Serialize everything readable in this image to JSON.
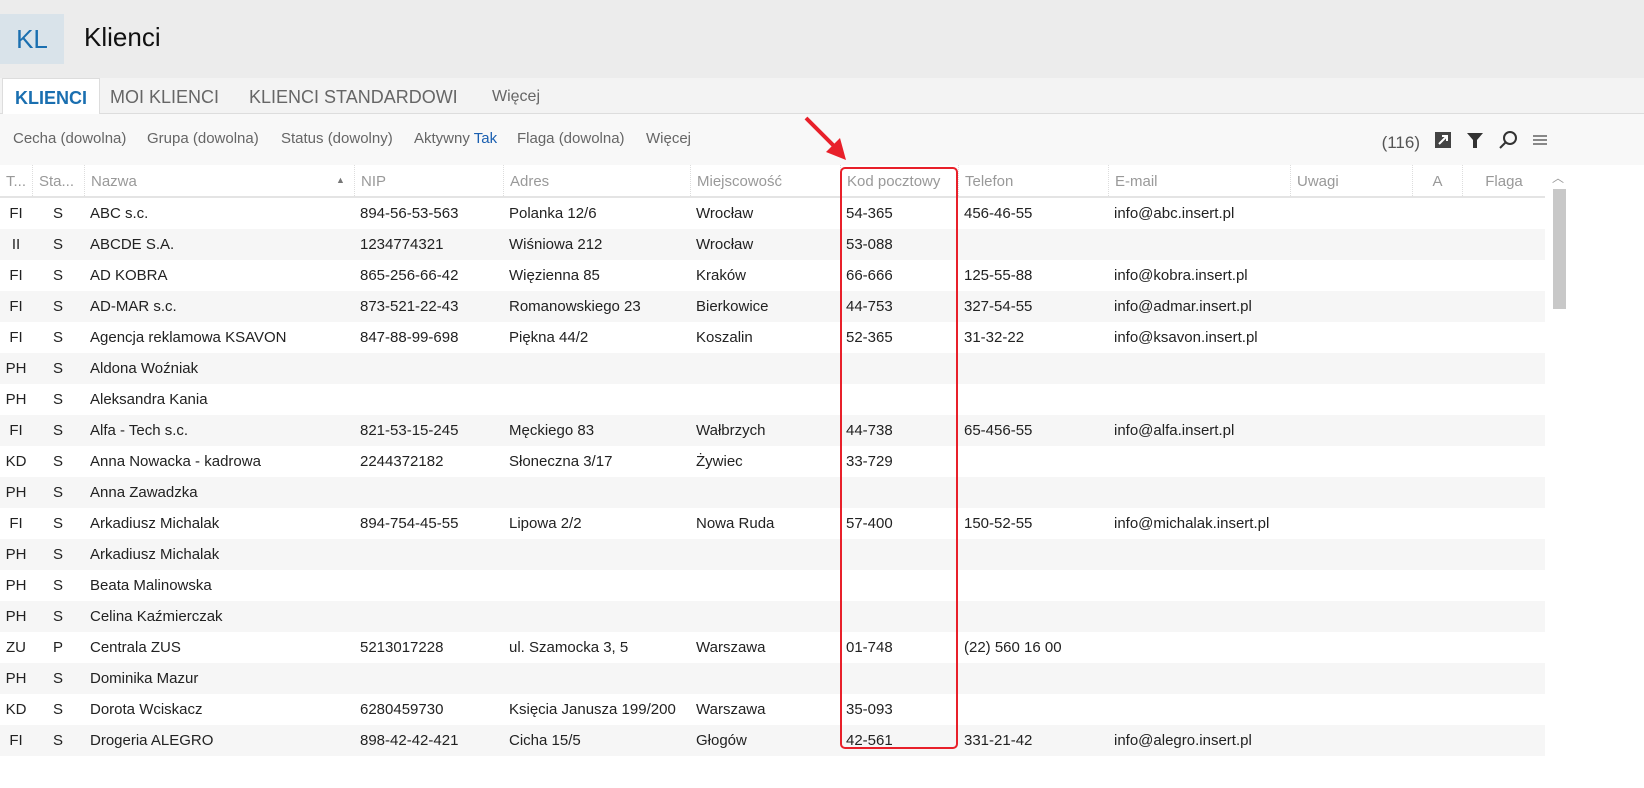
{
  "header": {
    "badge": "KL",
    "title": "Klienci"
  },
  "tabs": [
    {
      "label": "KLIENCI"
    },
    {
      "label": "MOI KLIENCI"
    },
    {
      "label": "KLIENCI STANDARDOWI"
    },
    {
      "label": "Więcej"
    }
  ],
  "filters": {
    "cecha": "Cecha (dowolna)",
    "grupa": "Grupa (dowolna)",
    "status": "Status (dowolny)",
    "aktywny_label": "Aktywny",
    "aktywny_value": "Tak",
    "flaga": "Flaga (dowolna)",
    "more": "Więcej"
  },
  "toolbar": {
    "count": "(116)"
  },
  "columns": [
    "T...",
    "Sta...",
    "Nazwa",
    "NIP",
    "Adres",
    "Miejscowość",
    "Kod pocztowy",
    "Telefon",
    "E-mail",
    "Uwagi",
    "A",
    "Flaga"
  ],
  "rows": [
    [
      "FI",
      "S",
      "ABC s.c.",
      "894-56-53-563",
      "Polanka  12/6",
      "Wrocław",
      "54-365",
      "456-46-55",
      "info@abc.insert.pl"
    ],
    [
      "II",
      "S",
      "ABCDE S.A.",
      "1234774321",
      "Wiśniowa 212",
      "Wrocław",
      "53-088",
      "",
      ""
    ],
    [
      "FI",
      "S",
      "AD KOBRA",
      "865-256-66-42",
      "Więzienna  85",
      "Kraków",
      "66-666",
      "125-55-88",
      "info@kobra.insert.pl"
    ],
    [
      "FI",
      "S",
      "AD-MAR s.c.",
      "873-521-22-43",
      "Romanowskiego 23",
      "Bierkowice",
      "44-753",
      "327-54-55",
      "info@admar.insert.pl"
    ],
    [
      "FI",
      "S",
      "Agencja reklamowa KSAVON",
      "847-88-99-698",
      "Piękna  44/2",
      "Koszalin",
      "52-365",
      "31-32-22",
      "info@ksavon.insert.pl"
    ],
    [
      "PH",
      "S",
      "Aldona Woźniak",
      "",
      "",
      "",
      "",
      "",
      ""
    ],
    [
      "PH",
      "S",
      "Aleksandra Kania",
      "",
      "",
      "",
      "",
      "",
      ""
    ],
    [
      "FI",
      "S",
      "Alfa - Tech s.c.",
      "821-53-15-245",
      "Męckiego  83",
      "Wałbrzych",
      "44-738",
      "65-456-55",
      "info@alfa.insert.pl"
    ],
    [
      "KD",
      "S",
      "Anna Nowacka - kadrowa",
      "2244372182",
      "Słoneczna 3/17",
      "Żywiec",
      "33-729",
      "",
      ""
    ],
    [
      "PH",
      "S",
      "Anna Zawadzka",
      "",
      "",
      "",
      "",
      "",
      ""
    ],
    [
      "FI",
      "S",
      "Arkadiusz Michalak",
      "894-754-45-55",
      "Lipowa  2/2",
      "Nowa Ruda",
      "57-400",
      "150-52-55",
      "info@michalak.insert.pl"
    ],
    [
      "PH",
      "S",
      "Arkadiusz Michalak",
      "",
      "",
      "",
      "",
      "",
      ""
    ],
    [
      "PH",
      "S",
      "Beata Malinowska",
      "",
      "",
      "",
      "",
      "",
      ""
    ],
    [
      "PH",
      "S",
      "Celina Kaźmierczak",
      "",
      "",
      "",
      "",
      "",
      ""
    ],
    [
      "ZU",
      "P",
      "Centrala ZUS",
      "5213017228",
      "ul. Szamocka 3, 5",
      "Warszawa",
      "01-748",
      "(22) 560 16 00",
      ""
    ],
    [
      "PH",
      "S",
      "Dominika Mazur",
      "",
      "",
      "",
      "",
      "",
      ""
    ],
    [
      "KD",
      "S",
      "Dorota Wciskacz",
      "6280459730",
      "Księcia Janusza 199/200",
      "Warszawa",
      "35-093",
      "",
      ""
    ],
    [
      "FI",
      "S",
      "Drogeria ALEGRO",
      "898-42-42-421",
      "Cicha  15/5",
      "Głogów",
      "42-561",
      "331-21-42",
      "info@alegro.insert.pl"
    ]
  ],
  "colors": {
    "accent": "#1a6fb0",
    "highlight": "#e8202a"
  }
}
